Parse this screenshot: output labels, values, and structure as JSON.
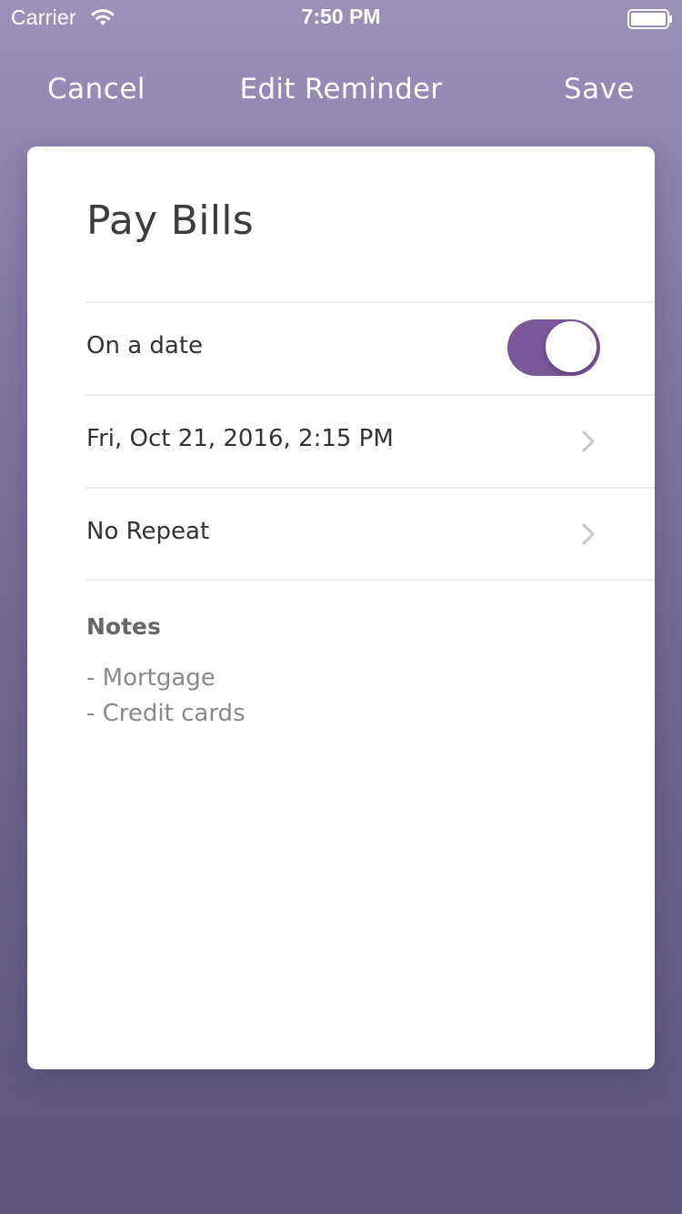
{
  "status_bar": {
    "carrier": "Carrier",
    "wifi_icon": "wifi-icon",
    "time": "7:50 PM",
    "battery_icon": "battery-icon"
  },
  "nav": {
    "cancel_label": "Cancel",
    "title": "Edit Reminder",
    "save_label": "Save"
  },
  "reminder": {
    "title": "Pay Bills",
    "on_a_date": {
      "label": "On a date",
      "enabled": true
    },
    "date": {
      "value": "Fri, Oct 21, 2016, 2:15 PM",
      "icon": "chevron-right-icon"
    },
    "repeat": {
      "value": "No Repeat",
      "icon": "chevron-right-icon"
    },
    "notes": {
      "heading": "Notes",
      "lines": [
        "- Mortgage",
        "- Credit cards"
      ]
    }
  },
  "colors": {
    "accent": "#7a5799",
    "background_top": "#9b91b9",
    "background_bottom": "#5d5579",
    "card": "#ffffff"
  }
}
